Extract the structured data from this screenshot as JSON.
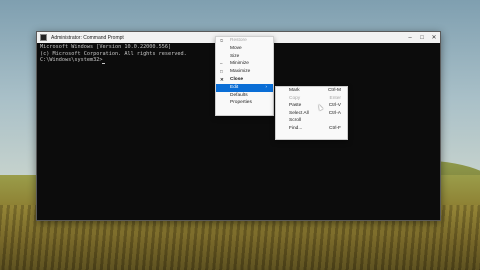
{
  "window": {
    "title": "Administrator: Command Prompt",
    "controls": {
      "minimize": "–",
      "maximize": "□",
      "close": "✕"
    }
  },
  "console": {
    "lines": [
      "Microsoft Windows [Version 10.0.22000.556]",
      "(c) Microsoft Corporation. All rights reserved.",
      "",
      "C:\\Windows\\system32>"
    ]
  },
  "system_menu": {
    "items": [
      {
        "label": "Restore",
        "icon": "⧉",
        "disabled": true
      },
      {
        "label": "Move"
      },
      {
        "label": "Size"
      },
      {
        "label": "Minimize",
        "icon": "–"
      },
      {
        "label": "Maximize",
        "icon": "□"
      },
      {
        "label": "Close",
        "icon": "✕",
        "bold": true
      },
      {
        "label": "Edit",
        "highlighted": true,
        "arrow": "›"
      },
      {
        "label": "Defaults"
      },
      {
        "label": "Properties"
      }
    ]
  },
  "edit_menu": {
    "items": [
      {
        "label": "Mark",
        "shortcut": "Ctrl-M"
      },
      {
        "label": "Copy",
        "shortcut": "Enter",
        "disabled": true
      },
      {
        "label": "Paste",
        "shortcut": "Ctrl-V"
      },
      {
        "label": "Select All",
        "shortcut": "Ctrl-A"
      },
      {
        "label": "Scroll",
        "shortcut": ""
      },
      {
        "label": "Find...",
        "shortcut": "Ctrl-F"
      }
    ]
  },
  "colors": {
    "accent": "#0a6ed6",
    "console_bg": "#0c0c0c",
    "console_fg": "#c8c8c8"
  }
}
